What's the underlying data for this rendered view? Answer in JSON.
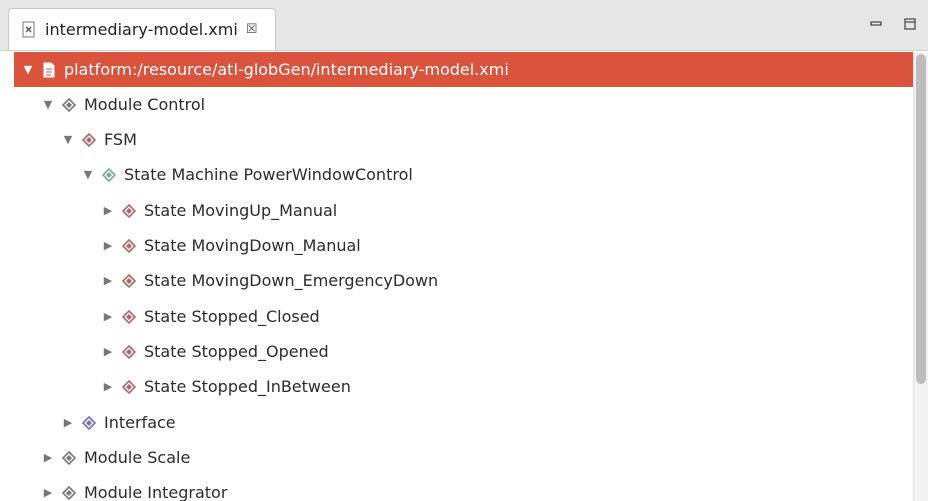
{
  "editor": {
    "tab_title": "intermediary-model.xmi",
    "tab_close_glyph": "☒",
    "minimize_icon": "minimize-icon",
    "maximize_icon": "maximize-icon"
  },
  "colors": {
    "selection": "#d9533d",
    "state_icon": "#b36464",
    "module_icon": "#777777",
    "machine_icon": "#7aa8a0",
    "interface_icon": "#7a6fc0"
  },
  "tree": {
    "resource": "platform:/resource/atl-globGen/intermediary-model.xmi",
    "module_control": "Module Control",
    "fsm": "FSM",
    "state_machine": "State Machine PowerWindowControl",
    "states": [
      "State MovingUp_Manual",
      "State MovingDown_Manual",
      "State MovingDown_EmergencyDown",
      "State Stopped_Closed",
      "State Stopped_Opened",
      "State Stopped_InBetween"
    ],
    "interface": "Interface",
    "module_scale": "Module Scale",
    "module_integrator": "Module Integrator"
  }
}
